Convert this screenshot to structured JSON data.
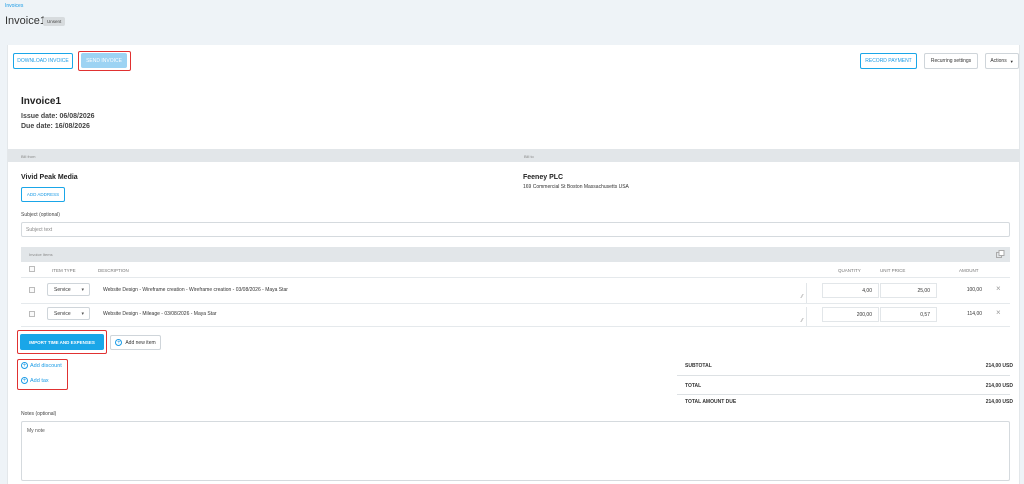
{
  "breadcrumb": "Invoices",
  "page_title": "Invoice1",
  "status_badge": "Unsent",
  "toolbar": {
    "download": "DOWNLOAD INVOICE",
    "send": "SEND INVOICE",
    "record_payment": "RECORD PAYMENT",
    "recurring": "Recurring settings",
    "actions": "Actions"
  },
  "invoice": {
    "title": "Invoice1",
    "issue_date": "Issue date: 06/08/2026",
    "due_date": "Due date: 16/08/2026"
  },
  "bill_from": {
    "label": "Bill from",
    "name": "Vivid Peak Media",
    "add_address": "ADD ADDRESS"
  },
  "bill_to": {
    "label": "Bill to",
    "name": "Feeney PLC",
    "address": "169 Commercial St Boston Massachusetts USA"
  },
  "subject": {
    "label": "Subject (optional)",
    "placeholder": "Subject text"
  },
  "items": {
    "section_label": "Invoice Items",
    "columns": {
      "type": "ITEM TYPE",
      "description": "DESCRIPTION",
      "quantity": "QUANTITY",
      "unit_price": "UNIT PRICE",
      "amount": "AMOUNT"
    },
    "rows": [
      {
        "type": "Service",
        "description": "Website Design - Wireframe creation - Wireframe creation - 03/08/2026 - Maya Star",
        "quantity": "4,00",
        "unit_price": "25,00",
        "amount": "100,00"
      },
      {
        "type": "Service",
        "description": "Website Design - Mileage - 03/08/2026 - Maya Star",
        "quantity": "200,00",
        "unit_price": "0,57",
        "amount": "114,00"
      }
    ]
  },
  "actions": {
    "import": "IMPORT TIME AND EXPENSES",
    "add_item": "Add new item",
    "add_discount": "Add discount",
    "add_tax": "Add tax"
  },
  "totals": {
    "subtotal_label": "SUBTOTAL",
    "subtotal": "214,00 USD",
    "total_label": "TOTAL",
    "total": "214,00 USD",
    "due_label": "TOTAL AMOUNT DUE",
    "due": "214,00 USD"
  },
  "notes": {
    "label": "Notes (optional)",
    "value": "My note"
  },
  "colors": {
    "accent": "#1aa6e8",
    "highlight": "#e03131"
  }
}
